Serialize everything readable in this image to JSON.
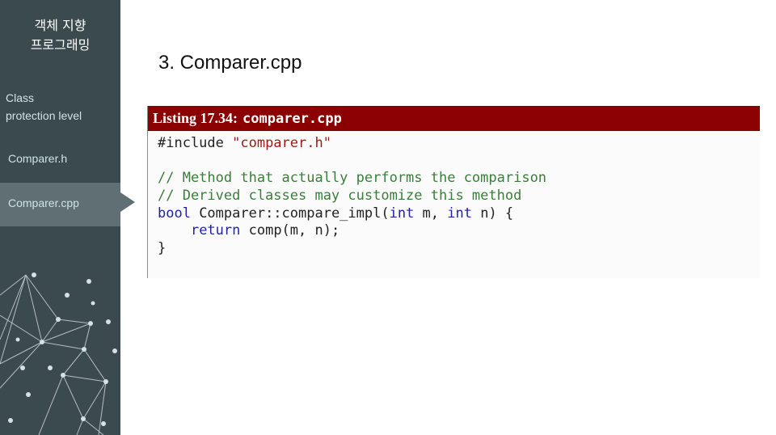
{
  "sidebar": {
    "course_title_line1": "객체 지향",
    "course_title_line2": "프로그래밍",
    "items": [
      {
        "label_line1": "Class",
        "label_line2": "protection level"
      },
      {
        "label": "Comparer.h"
      },
      {
        "label": "Comparer.cpp",
        "active": true
      }
    ]
  },
  "slide": {
    "title": "3. Comparer.cpp"
  },
  "listing": {
    "label": "Listing 17.34:",
    "filename": "comparer.cpp",
    "code": {
      "line1_directive": "#include ",
      "line1_string": "\"comparer.h\"",
      "line2": "",
      "line3_comment": "// Method that actually performs the comparison",
      "line4_comment": "// Derived classes may customize this method",
      "line5_kw1": "bool",
      "line5_text1": " Comparer::compare_impl(",
      "line5_kw2": "int",
      "line5_text2": " m, ",
      "line5_kw3": "int",
      "line5_text3": " n) {",
      "line6_indent": "    ",
      "line6_kw": "return",
      "line6_text": " comp(m, n);",
      "line7": "}"
    }
  },
  "colors": {
    "sidebar_bg": "#3b4a4f",
    "sidebar_active_bg": "#5f6f73",
    "listing_header_bg": "#8b0000",
    "keyword": "#1f1fa8",
    "comment": "#3a7d3a",
    "string": "#a11a1a"
  }
}
